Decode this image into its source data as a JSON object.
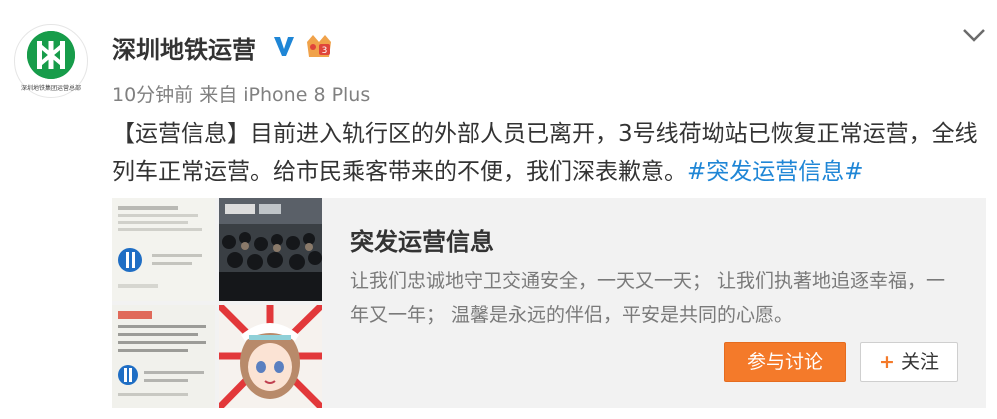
{
  "post": {
    "author": "深圳地铁运营",
    "avatar_caption": "深圳地铁集团运营总部",
    "time": "10分钟前",
    "source": "来自 iPhone 8 Plus",
    "text_before": "【运营信息】目前进入轨行区的外部人员已离开，3号线荷坳站已恢复正常运营，全线列车正常运营。给市民乘客带来的不便，我们深表歉意。",
    "topic": "#突发运营信息#",
    "badge_level": "3"
  },
  "card": {
    "title": "突发运营信息",
    "description": "让我们忠诚地守卫交通安全，一天又一天； 让我们执著地追逐幸福，一年又一年； 温馨是永远的伴侣，平安是共同的心愿。",
    "discuss_label": "参与讨论",
    "follow_label": "关注"
  },
  "colors": {
    "accent_orange": "#f47a2a",
    "link_blue": "#1f86d6",
    "verified_blue": "#1f86d6",
    "metro_green": "#179c4a"
  },
  "icons": [
    "shenzhen-metro-logo",
    "verified-v-icon",
    "vip-level-icon",
    "chevron-down-icon",
    "plus-icon"
  ]
}
